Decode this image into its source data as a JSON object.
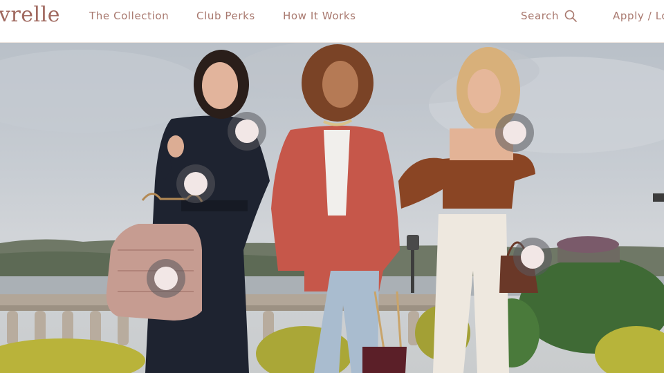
{
  "header": {
    "logo": "vrelle",
    "nav": {
      "collection": "The Collection",
      "perks": "Club Perks",
      "how": "How It Works"
    },
    "search_label": "Search",
    "apply_label": "Apply / Lo"
  },
  "hero": {
    "hotspots": [
      {
        "name": "hotspot-black-dress"
      },
      {
        "name": "hotspot-black-dress-belt"
      },
      {
        "name": "hotspot-quilted-bag"
      },
      {
        "name": "hotspot-rust-top"
      },
      {
        "name": "hotspot-brown-handbag"
      }
    ]
  },
  "colors": {
    "brand": "#a0695f",
    "nav_text": "#a8786e",
    "hotspot_ring": "#5a5a5f",
    "hotspot_dot": "#f2e7e6"
  },
  "icons": {
    "search": "magnifier-icon"
  }
}
